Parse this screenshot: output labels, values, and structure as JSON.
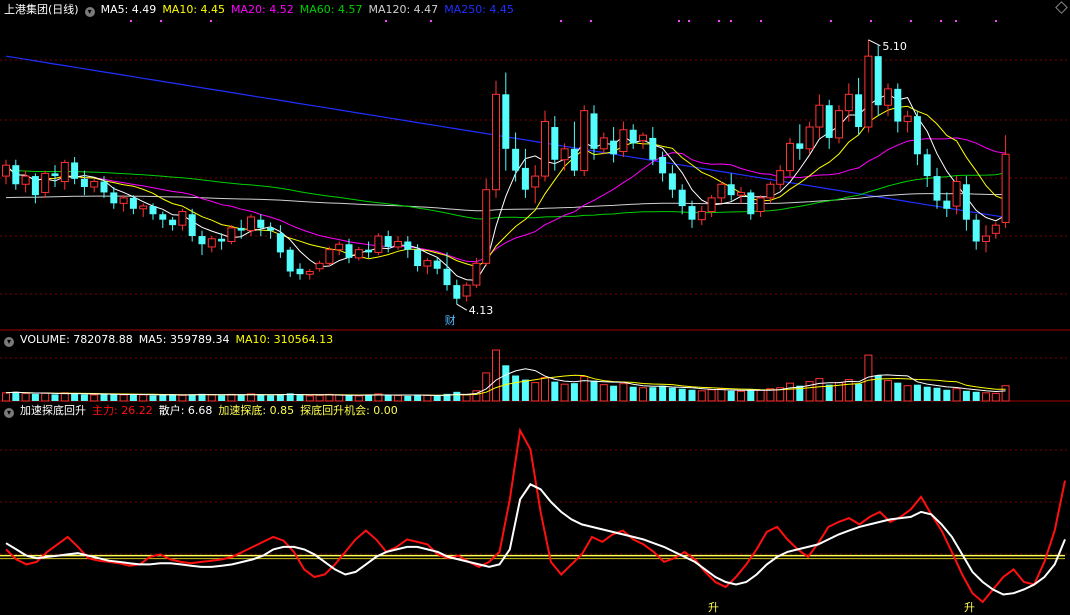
{
  "main_header": {
    "title": "上港集团(日线)",
    "ma5": "MA5: 4.49",
    "ma10": "MA10: 4.45",
    "ma20": "MA20: 4.52",
    "ma60": "MA60: 4.57",
    "ma120": "MA120: 4.47",
    "ma250": "MA250: 4.45"
  },
  "vol_header": {
    "volume": "VOLUME: 782078.88",
    "ma5": "MA5: 359789.34",
    "ma10": "MA10: 310564.13"
  },
  "ind_header": {
    "name": "加速探底回升",
    "main": "主力: 26.22",
    "retail": "散户: 6.68",
    "accel": "加速探底: 0.85",
    "chance": "探底回升机会: 0.00"
  },
  "colors": {
    "up": "#ff3232",
    "down": "#54fcfc",
    "ma5": "#ffffff",
    "ma10": "#ffff00",
    "ma20": "#ff00ff",
    "ma60": "#00d000",
    "ma120": "#d0d0d0",
    "ma250": "#2030ff",
    "main": "#ff1010",
    "retail": "#ffffff",
    "threshold": "#ffff50"
  },
  "icons": {
    "toggle": "chevron-down-icon",
    "marker": "diamond-icon"
  },
  "chart_data": [
    {
      "type": "candlestick",
      "annotations": {
        "high": "5.10",
        "low": "4.13",
        "finance_mark": "财"
      },
      "ylim": [
        4.05,
        5.18
      ],
      "candles": [
        [
          4.6,
          4.66,
          4.64,
          4.57
        ],
        [
          4.64,
          4.66,
          4.57,
          4.55
        ],
        [
          4.57,
          4.62,
          4.6,
          4.54
        ],
        [
          4.6,
          4.61,
          4.53,
          4.5
        ],
        [
          4.54,
          4.62,
          4.61,
          4.52
        ],
        [
          4.61,
          4.64,
          4.6,
          4.56
        ],
        [
          4.58,
          4.66,
          4.65,
          4.55
        ],
        [
          4.65,
          4.67,
          4.59,
          4.57
        ],
        [
          4.59,
          4.62,
          4.56,
          4.53
        ],
        [
          4.56,
          4.59,
          4.58,
          4.54
        ],
        [
          4.58,
          4.6,
          4.54,
          4.52
        ],
        [
          4.54,
          4.56,
          4.5,
          4.48
        ],
        [
          4.5,
          4.53,
          4.52,
          4.47
        ],
        [
          4.52,
          4.53,
          4.48,
          4.46
        ],
        [
          4.48,
          4.5,
          4.49,
          4.45
        ],
        [
          4.49,
          4.5,
          4.46,
          4.44
        ],
        [
          4.46,
          4.47,
          4.44,
          4.41
        ],
        [
          4.44,
          4.45,
          4.42,
          4.4
        ],
        [
          4.42,
          4.48,
          4.47,
          4.4
        ],
        [
          4.46,
          4.48,
          4.38,
          4.36
        ],
        [
          4.38,
          4.4,
          4.35,
          4.31
        ],
        [
          4.34,
          4.38,
          4.37,
          4.32
        ],
        [
          4.37,
          4.39,
          4.36,
          4.33
        ],
        [
          4.36,
          4.42,
          4.41,
          4.35
        ],
        [
          4.41,
          4.44,
          4.4,
          4.37
        ],
        [
          4.4,
          4.46,
          4.45,
          4.38
        ],
        [
          4.44,
          4.46,
          4.41,
          4.38
        ],
        [
          4.41,
          4.43,
          4.4,
          4.37
        ],
        [
          4.39,
          4.42,
          4.32,
          4.3
        ],
        [
          4.33,
          4.34,
          4.25,
          4.23
        ],
        [
          4.26,
          4.28,
          4.24,
          4.22
        ],
        [
          4.24,
          4.26,
          4.25,
          4.22
        ],
        [
          4.26,
          4.29,
          4.28,
          4.25
        ],
        [
          4.28,
          4.34,
          4.33,
          4.27
        ],
        [
          4.33,
          4.36,
          4.35,
          4.31
        ],
        [
          4.35,
          4.37,
          4.3,
          4.28
        ],
        [
          4.3,
          4.34,
          4.33,
          4.29
        ],
        [
          4.33,
          4.36,
          4.32,
          4.3
        ],
        [
          4.32,
          4.39,
          4.38,
          4.31
        ],
        [
          4.38,
          4.4,
          4.34,
          4.32
        ],
        [
          4.34,
          4.38,
          4.36,
          4.33
        ],
        [
          4.36,
          4.38,
          4.33,
          4.3
        ],
        [
          4.33,
          4.35,
          4.27,
          4.25
        ],
        [
          4.27,
          4.3,
          4.29,
          4.24
        ],
        [
          4.29,
          4.3,
          4.26,
          4.24
        ],
        [
          4.26,
          4.32,
          4.2,
          4.18
        ],
        [
          4.2,
          4.22,
          4.15,
          4.13
        ],
        [
          4.16,
          4.21,
          4.2,
          4.14
        ],
        [
          4.2,
          4.3,
          4.28,
          4.19
        ],
        [
          4.28,
          4.59,
          4.55,
          4.27
        ],
        [
          4.55,
          4.95,
          4.9,
          4.52
        ],
        [
          4.9,
          4.98,
          4.7,
          4.62
        ],
        [
          4.7,
          4.76,
          4.62,
          4.58
        ],
        [
          4.63,
          4.7,
          4.55,
          4.52
        ],
        [
          4.56,
          4.64,
          4.6,
          4.5
        ],
        [
          4.6,
          4.84,
          4.8,
          4.58
        ],
        [
          4.78,
          4.82,
          4.66,
          4.62
        ],
        [
          4.66,
          4.72,
          4.7,
          4.62
        ],
        [
          4.7,
          4.8,
          4.62,
          4.6
        ],
        [
          4.62,
          4.86,
          4.84,
          4.6
        ],
        [
          4.83,
          4.86,
          4.7,
          4.66
        ],
        [
          4.7,
          4.76,
          4.74,
          4.68
        ],
        [
          4.73,
          4.78,
          4.68,
          4.65
        ],
        [
          4.69,
          4.8,
          4.77,
          4.67
        ],
        [
          4.77,
          4.79,
          4.72,
          4.7
        ],
        [
          4.73,
          4.76,
          4.75,
          4.7
        ],
        [
          4.74,
          4.78,
          4.66,
          4.64
        ],
        [
          4.67,
          4.69,
          4.61,
          4.58
        ],
        [
          4.61,
          4.64,
          4.55,
          4.52
        ],
        [
          4.55,
          4.57,
          4.49,
          4.46
        ],
        [
          4.49,
          4.51,
          4.44,
          4.41
        ],
        [
          4.44,
          4.49,
          4.47,
          4.42
        ],
        [
          4.47,
          4.53,
          4.52,
          4.45
        ],
        [
          4.52,
          4.58,
          4.57,
          4.5
        ],
        [
          4.57,
          4.61,
          4.53,
          4.51
        ],
        [
          4.53,
          4.56,
          4.54,
          4.5
        ],
        [
          4.54,
          4.55,
          4.46,
          4.44
        ],
        [
          4.47,
          4.53,
          4.52,
          4.45
        ],
        [
          4.52,
          4.58,
          4.57,
          4.5
        ],
        [
          4.57,
          4.64,
          4.62,
          4.55
        ],
        [
          4.62,
          4.74,
          4.72,
          4.6
        ],
        [
          4.72,
          4.79,
          4.7,
          4.66
        ],
        [
          4.7,
          4.8,
          4.78,
          4.68
        ],
        [
          4.78,
          4.9,
          4.86,
          4.74
        ],
        [
          4.86,
          4.88,
          4.74,
          4.7
        ],
        [
          4.74,
          4.86,
          4.84,
          4.72
        ],
        [
          4.84,
          4.94,
          4.9,
          4.8
        ],
        [
          4.9,
          4.96,
          4.78,
          4.75
        ],
        [
          4.78,
          5.1,
          5.04,
          4.76
        ],
        [
          5.04,
          5.08,
          4.86,
          4.82
        ],
        [
          4.86,
          4.94,
          4.92,
          4.82
        ],
        [
          4.92,
          4.94,
          4.8,
          4.76
        ],
        [
          4.8,
          4.84,
          4.82,
          4.76
        ],
        [
          4.82,
          4.84,
          4.68,
          4.64
        ],
        [
          4.68,
          4.7,
          4.6,
          4.56
        ],
        [
          4.6,
          4.63,
          4.51,
          4.48
        ],
        [
          4.51,
          4.54,
          4.48,
          4.45
        ],
        [
          4.49,
          4.6,
          4.58,
          4.46
        ],
        [
          4.57,
          4.6,
          4.44,
          4.4
        ],
        [
          4.44,
          4.46,
          4.36,
          4.33
        ],
        [
          4.36,
          4.42,
          4.38,
          4.32
        ],
        [
          4.39,
          4.43,
          4.42,
          4.37
        ],
        [
          4.43,
          4.75,
          4.68,
          4.41
        ]
      ]
    },
    {
      "type": "bar",
      "name": "VOLUME",
      "values": [
        0.16,
        0.18,
        0.15,
        0.14,
        0.15,
        0.13,
        0.16,
        0.15,
        0.13,
        0.12,
        0.13,
        0.14,
        0.12,
        0.13,
        0.12,
        0.11,
        0.12,
        0.13,
        0.11,
        0.13,
        0.14,
        0.12,
        0.11,
        0.13,
        0.12,
        0.14,
        0.12,
        0.11,
        0.13,
        0.15,
        0.12,
        0.1,
        0.11,
        0.13,
        0.12,
        0.11,
        0.1,
        0.12,
        0.14,
        0.12,
        0.11,
        0.1,
        0.12,
        0.11,
        0.1,
        0.14,
        0.18,
        0.12,
        0.2,
        0.55,
        1.0,
        0.7,
        0.5,
        0.42,
        0.36,
        0.46,
        0.38,
        0.33,
        0.35,
        0.48,
        0.4,
        0.32,
        0.3,
        0.34,
        0.28,
        0.26,
        0.27,
        0.3,
        0.26,
        0.24,
        0.22,
        0.2,
        0.22,
        0.24,
        0.2,
        0.19,
        0.22,
        0.21,
        0.24,
        0.26,
        0.35,
        0.3,
        0.38,
        0.44,
        0.32,
        0.36,
        0.42,
        0.34,
        0.9,
        0.5,
        0.4,
        0.36,
        0.3,
        0.32,
        0.28,
        0.26,
        0.22,
        0.24,
        0.2,
        0.18,
        0.16,
        0.15,
        0.3
      ]
    },
    {
      "type": "line",
      "threshold": 35,
      "ylim": [
        -10,
        145
      ],
      "series": [
        {
          "name": "主力",
          "values": [
            40,
            32,
            28,
            30,
            38,
            44,
            50,
            42,
            33,
            31,
            30,
            29,
            27,
            28,
            34,
            36,
            32,
            30,
            29,
            30,
            31,
            32,
            34,
            38,
            42,
            46,
            50,
            47,
            38,
            24,
            18,
            20,
            28,
            38,
            48,
            55,
            48,
            38,
            42,
            48,
            46,
            44,
            36,
            33,
            35,
            30,
            26,
            30,
            38,
            80,
            135,
            120,
            70,
            30,
            20,
            28,
            36,
            50,
            46,
            52,
            55,
            48,
            44,
            38,
            30,
            33,
            38,
            32,
            22,
            14,
            10,
            18,
            28,
            40,
            54,
            58,
            48,
            40,
            34,
            45,
            58,
            62,
            65,
            60,
            66,
            70,
            62,
            66,
            72,
            82,
            68,
            55,
            38,
            20,
            5,
            -2,
            8,
            18,
            24,
            14,
            12,
            30,
            55,
            95
          ]
        },
        {
          "name": "散户",
          "values": [
            45,
            40,
            35,
            33,
            34,
            35,
            36,
            37,
            35,
            33,
            31,
            30,
            29,
            28,
            28,
            29,
            29,
            28,
            27,
            26,
            26,
            27,
            28,
            30,
            32,
            35,
            40,
            42,
            42,
            40,
            36,
            30,
            24,
            20,
            22,
            28,
            34,
            38,
            40,
            42,
            42,
            40,
            38,
            34,
            32,
            30,
            28,
            26,
            28,
            40,
            80,
            92,
            88,
            78,
            70,
            64,
            60,
            58,
            56,
            54,
            52,
            50,
            48,
            45,
            42,
            38,
            34,
            30,
            24,
            18,
            14,
            12,
            14,
            20,
            28,
            34,
            38,
            40,
            42,
            44,
            48,
            52,
            55,
            58,
            60,
            62,
            64,
            65,
            66,
            70,
            68,
            60,
            50,
            36,
            22,
            14,
            8,
            4,
            5,
            8,
            12,
            18,
            28,
            48
          ]
        }
      ],
      "signal_marks": [
        "升",
        "升"
      ]
    }
  ]
}
